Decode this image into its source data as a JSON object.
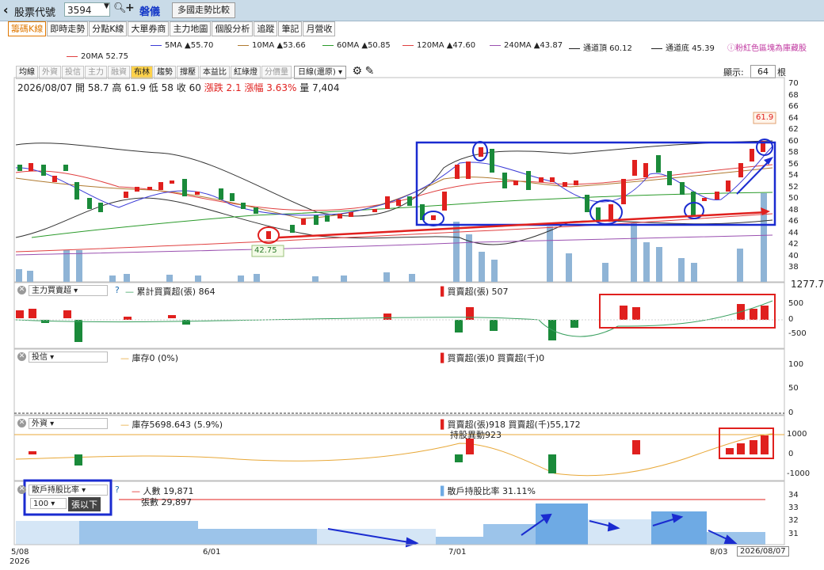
{
  "header": {
    "back_icon": "chevron-left-icon",
    "stock_code_label": "股票代號",
    "stock_code_value": "3594",
    "stock_name": "磐儀",
    "compare_button": "多國走勢比較"
  },
  "tabs": [
    "籌碼K線",
    "即時走勢",
    "分點K線",
    "大單券商",
    "主力地圖",
    "個股分析",
    "追蹤",
    "筆記",
    "月營收"
  ],
  "active_tab": "籌碼K線",
  "ma_legend": [
    {
      "label": "5MA ▲55.70",
      "color": "#3b3bd6"
    },
    {
      "label": "10MA ▲53.66",
      "color": "#b07a30"
    },
    {
      "label": "60MA ▲50.85",
      "color": "#2a9a2a"
    },
    {
      "label": "120MA ▲47.60",
      "color": "#e04040"
    },
    {
      "label": "240MA ▲43.87",
      "color": "#9a50b0"
    },
    {
      "label": "通道頂 60.12",
      "color": "#222222"
    },
    {
      "label": "通道底 45.39",
      "color": "#222222"
    },
    {
      "label": "20MA 52.75",
      "color": "#e04040"
    }
  ],
  "tip_text": "粉紅色區塊為庫藏股",
  "toolbar": {
    "buttons": [
      "均線",
      "外資",
      "投信",
      "主力",
      "融資",
      "布林",
      "趨勢",
      "撐壓",
      "本益比",
      "紅綠燈",
      "分價量"
    ],
    "active": "布林",
    "dimmed": [
      "外資",
      "投信",
      "主力",
      "融資",
      "分價量"
    ],
    "period_select": "日線(還原)",
    "display_label": "顯示:",
    "display_value": "64",
    "display_unit": "根"
  },
  "ohlc": {
    "date": "2026/08/07",
    "open_label": "開",
    "open": "58.7",
    "high_label": "高",
    "high": "61.9",
    "low_label": "低",
    "low": "58",
    "close_label": "收",
    "close": "60",
    "change_label": "漲跌",
    "change": "2.1",
    "pct_label": "漲幅",
    "pct": "3.63%",
    "vol_label": "量",
    "vol": "7,404"
  },
  "price_axis": [
    "70",
    "68",
    "66",
    "64",
    "62",
    "60",
    "58",
    "56",
    "54",
    "52",
    "50",
    "48",
    "46",
    "44",
    "42",
    "40",
    "38"
  ],
  "price_callouts": {
    "high": "61.9",
    "low": "42.75"
  },
  "panel_main": {
    "select": "主力買賣超",
    "help": "?",
    "legend1": "累計買賣超(張) 864",
    "legend2": "買賣超(張) 507",
    "side_value": "1277.7",
    "axis": [
      "500",
      "0",
      "-500"
    ]
  },
  "panel_trust": {
    "select": "投信",
    "legend1": "庫存0 (0%)",
    "legend2": "買賣超(張)0 買賣超(千)0",
    "axis": [
      "100",
      "50",
      "0"
    ]
  },
  "panel_foreign": {
    "select": "外資",
    "legend1": "庫存5698.643 (5.9%)",
    "legend2": "買賣超(張)918 買賣超(千)55,172",
    "legend3": "持股異動923",
    "axis": [
      "1000",
      "0",
      "-1000"
    ]
  },
  "panel_holder": {
    "select": "散戶持股比率",
    "sub_select": "100",
    "sub_label": "張以下",
    "help": "?",
    "legend1": "人數 19,871",
    "legend2": "張數 29,897",
    "legend3": "散戶持股比率 31.11%",
    "axis": [
      "34",
      "33",
      "32",
      "31"
    ]
  },
  "dates": {
    "d1": "5/08",
    "d1_year": "2026",
    "d2": "6/01",
    "d3": "7/01",
    "d4": "8/03",
    "current": "2026/08/07"
  }
}
